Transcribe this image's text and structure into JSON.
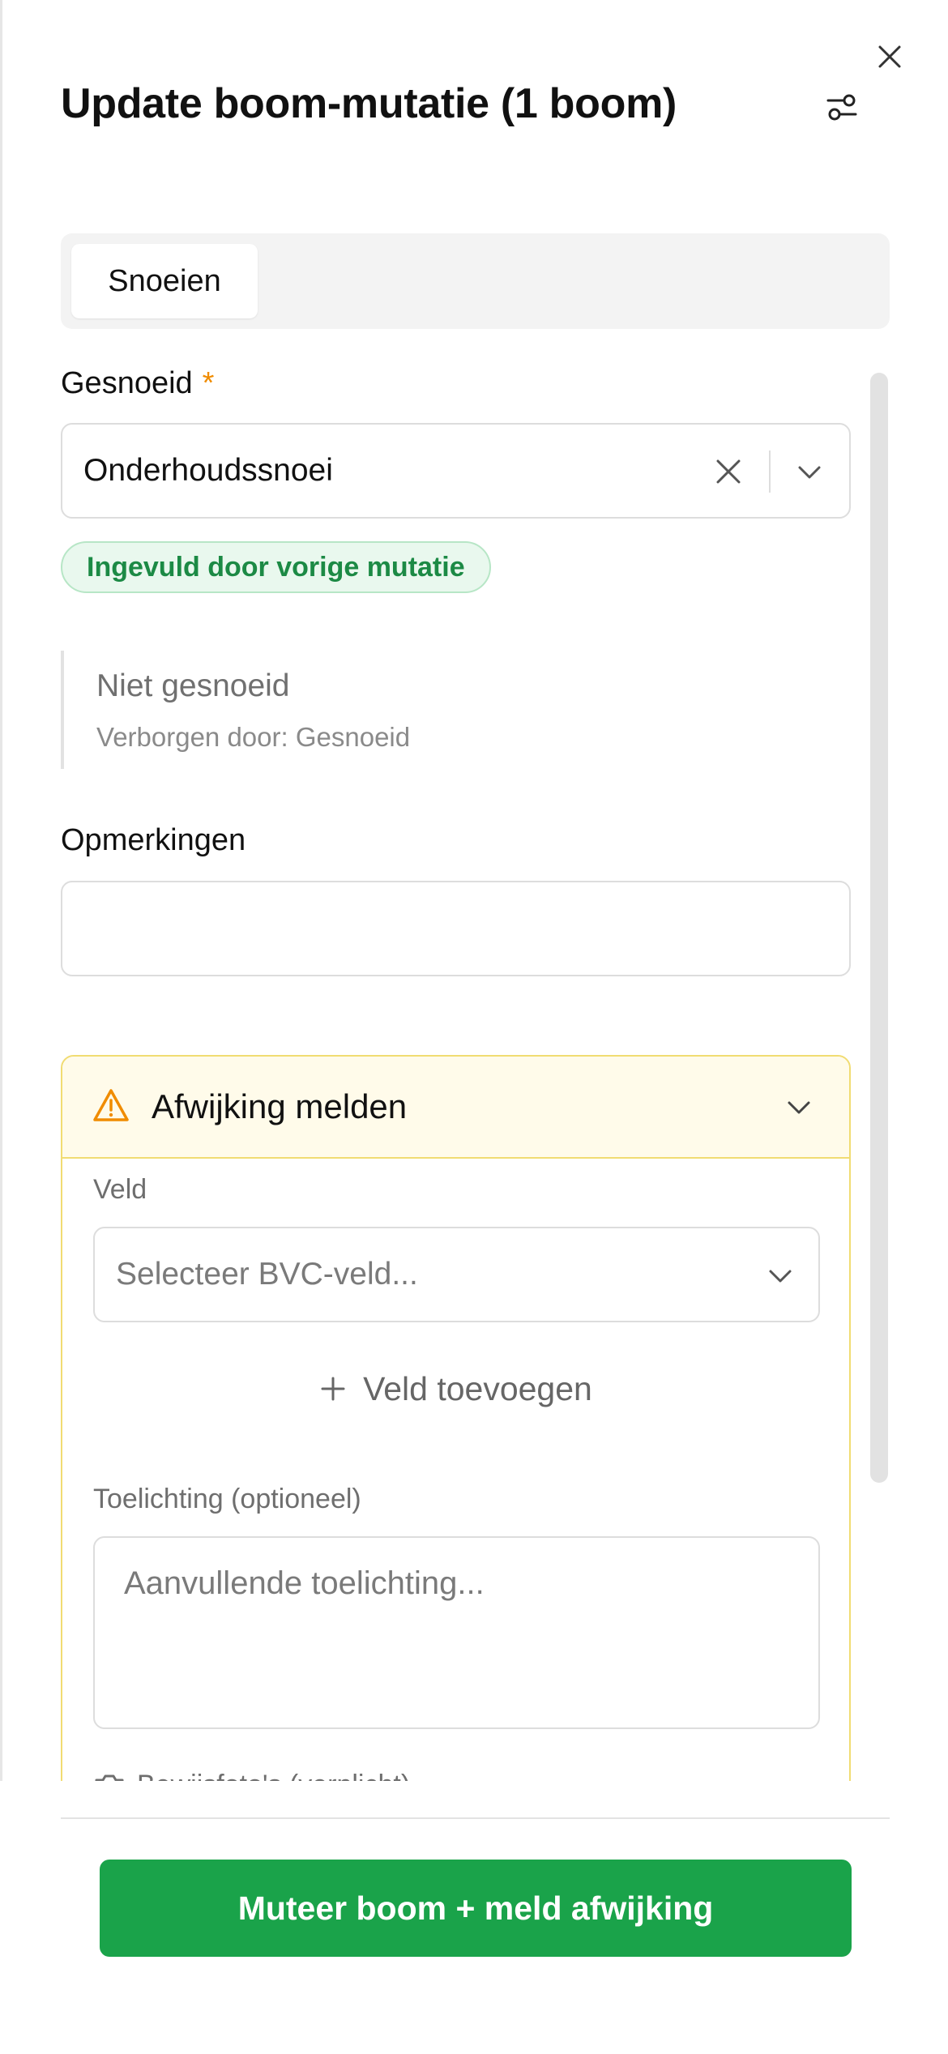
{
  "header": {
    "title": "Update boom-mutatie (1 boom)",
    "close_icon": "close-icon",
    "filter_icon": "sliders-icon"
  },
  "tabs": [
    {
      "label": "Snoeien",
      "active": true
    }
  ],
  "form": {
    "gesnoeid": {
      "label": "Gesnoeid",
      "required_mark": "*",
      "value": "Onderhoudssnoei",
      "badge": "Ingevuld door vorige mutatie"
    },
    "hidden_field": {
      "title": "Niet gesnoeid",
      "note": "Verborgen door: Gesnoeid"
    },
    "opmerkingen": {
      "label": "Opmerkingen",
      "value": ""
    }
  },
  "deviation": {
    "title": "Afwijking melden",
    "icon": "warning-icon",
    "field_label": "Veld",
    "field_placeholder": "Selecteer BVC-veld...",
    "add_field": "Veld toevoegen",
    "explanation_label": "Toelichting (optioneel)",
    "explanation_placeholder": "Aanvullende toelichting...",
    "photos_label": "Bewijsfoto's (verplicht)"
  },
  "footer": {
    "submit_label": "Muteer boom + meld afwijking"
  },
  "colors": {
    "primary_green": "#1aa34a",
    "warning_border": "#f1dc72",
    "warning_bg": "#fffbea",
    "warning_icon": "#f08c00",
    "badge_text": "#1c8a45"
  }
}
